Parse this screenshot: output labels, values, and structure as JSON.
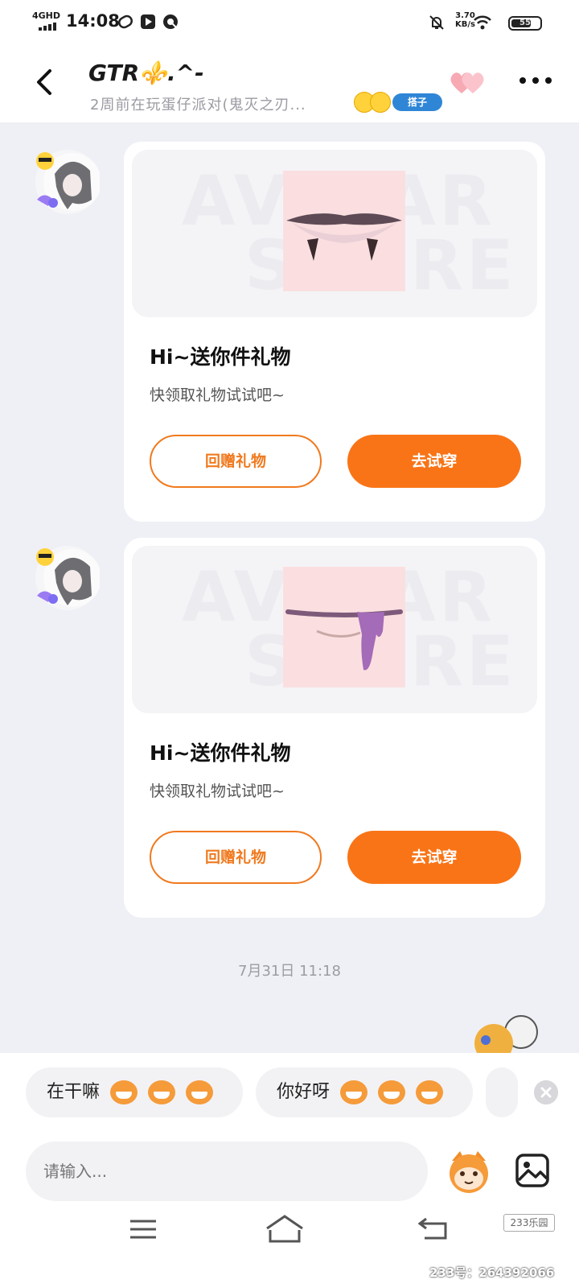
{
  "status_bar": {
    "network": "4GHD",
    "time": "14:08",
    "speed_value": "3.70",
    "speed_unit": "KB/s",
    "battery": "55"
  },
  "header": {
    "title": "GTR⚜️.^-",
    "subtitle": "2周前在玩蛋仔派对(鬼灭之刃...",
    "tag": "搭子"
  },
  "messages": [
    {
      "watermark_line1": "AVATAR",
      "watermark_line2": "STORE",
      "title": "Hi~送你件礼物",
      "desc": "快领取礼物试试吧~",
      "return_gift": "回赠礼物",
      "try_on": "去试穿"
    },
    {
      "watermark_line1": "AVATAR",
      "watermark_line2": "STORE",
      "title": "Hi~送你件礼物",
      "desc": "快领取礼物试试吧~",
      "return_gift": "回赠礼物",
      "try_on": "去试穿"
    }
  ],
  "date_divider": "7月31日 11:18",
  "quick_replies": [
    "在干嘛",
    "你好呀"
  ],
  "input": {
    "placeholder": "请输入..."
  },
  "watermark": {
    "logo": "233乐园",
    "text": "233号：264392066"
  },
  "colors": {
    "accent": "#f97417",
    "tag": "#2f86d6"
  }
}
